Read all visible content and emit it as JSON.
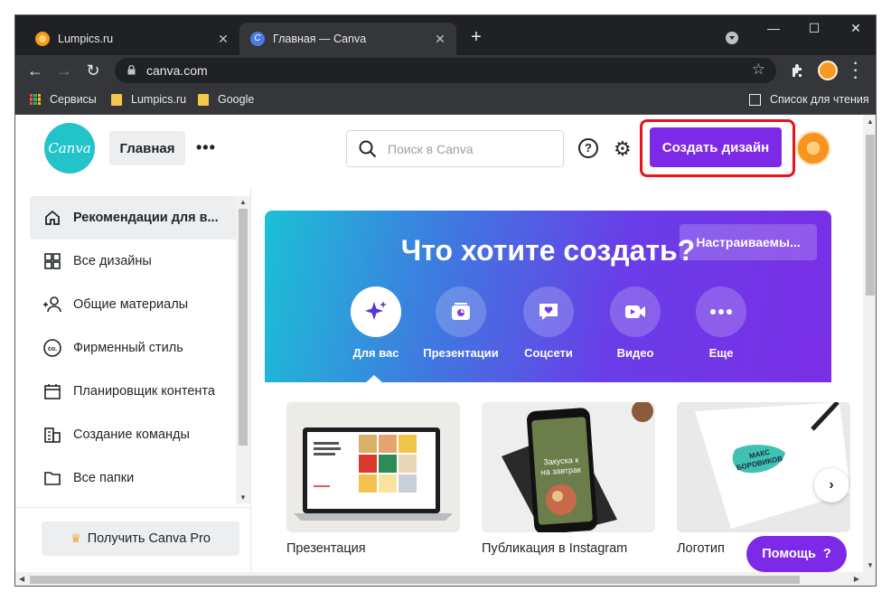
{
  "browser": {
    "tabs": [
      {
        "title": "Lumpics.ru",
        "active": false
      },
      {
        "title": "Главная — Canva",
        "active": true
      }
    ],
    "url": "canva.com",
    "bookmarks": [
      {
        "label": "Сервисы"
      },
      {
        "label": "Lumpics.ru"
      },
      {
        "label": "Google"
      }
    ],
    "reading_list": "Список для чтения"
  },
  "canva": {
    "logo_text": "Canva",
    "home_label": "Главная",
    "search_placeholder": "Поиск в Canva",
    "help_icon_text": "?",
    "create_label": "Создать дизайн",
    "sidebar": [
      {
        "label": "Рекомендации для в...",
        "icon": "home-icon",
        "selected": true
      },
      {
        "label": "Все дизайны",
        "icon": "grid-icon"
      },
      {
        "label": "Общие материалы",
        "icon": "shared-users-icon"
      },
      {
        "label": "Фирменный стиль",
        "icon": "brand-kit-icon"
      },
      {
        "label": "Планировщик контента",
        "icon": "calendar-icon"
      },
      {
        "label": "Создание команды",
        "icon": "building-icon"
      },
      {
        "label": "Все папки",
        "icon": "folder-icon"
      }
    ],
    "pro_label": "Получить Canva Pro",
    "hero": {
      "title": "Что хотите создать?",
      "custom_label": "Настраиваемы...",
      "categories": [
        {
          "label": "Для вас",
          "icon": "sparkle-icon",
          "selected": true
        },
        {
          "label": "Презентации",
          "icon": "presentation-icon"
        },
        {
          "label": "Соцсети",
          "icon": "heart-chat-icon"
        },
        {
          "label": "Видео",
          "icon": "video-icon"
        },
        {
          "label": "Еще",
          "icon": "more-icon"
        }
      ]
    },
    "cards": [
      {
        "caption": "Презентация",
        "thumb_text": "Приём на работу нового сотрудника"
      },
      {
        "caption": "Публикация в Instagram",
        "thumb_text": "Закуска к на завтрак"
      },
      {
        "caption": "Логотип",
        "thumb_text": "МАКС БОРОВИКОВ"
      }
    ],
    "help_button": "Помощь",
    "help_button_mark": "?"
  },
  "colors": {
    "brand_purple": "#7d2ae8",
    "brand_teal": "#23c4c9",
    "highlight_red": "#e8121b"
  }
}
